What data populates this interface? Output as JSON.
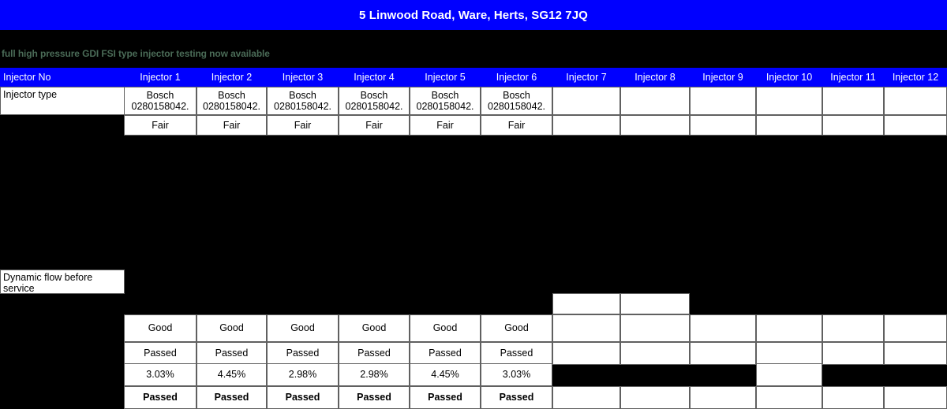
{
  "header": {
    "address": "5 Linwood Road, Ware, Herts, SG12 7JQ",
    "background_color": "#0000FF",
    "text_color": "#FFFFFF"
  },
  "marquee": {
    "text": "full high pressure GDI FSI type injector testing now available"
  },
  "table": {
    "header_background": "#0000FF",
    "header_text_color": "#FFFFFF",
    "row_label_header": "Injector No",
    "columns": [
      "Injector 1",
      "Injector 2",
      "Injector 3",
      "Injector 4",
      "Injector 5",
      "Injector 6",
      "Injector 7",
      "Injector 8",
      "Injector 9",
      "Injector 10",
      "Injector 11",
      "Injector 12"
    ],
    "rows": [
      {
        "label": "Injector type",
        "label_visible": true,
        "values": [
          "Bosch\n0280158042.",
          "Bosch\n0280158042.",
          "Bosch\n0280158042.",
          "Bosch\n0280158042.",
          "Bosch\n0280158042.",
          "Bosch\n0280158042.",
          "",
          "",
          "",
          "",
          "",
          ""
        ]
      },
      {
        "label": "",
        "label_visible": false,
        "values": [
          "Fair",
          "Fair",
          "Fair",
          "Fair",
          "Fair",
          "Fair",
          "",
          "",
          "",
          "",
          "",
          ""
        ]
      },
      {
        "label": "Dynamic flow before service",
        "label_visible": true,
        "values": [
          "",
          "",
          "",
          "",
          "",
          "",
          "",
          "",
          "",
          "",
          "",
          ""
        ]
      },
      {
        "label": "",
        "label_visible": false,
        "values": [
          "",
          "",
          "",
          "",
          "",
          "",
          "",
          "",
          "",
          "",
          "",
          ""
        ]
      },
      {
        "label": "",
        "label_visible": false,
        "values": [
          "Good",
          "Good",
          "Good",
          "Good",
          "Good",
          "Good",
          "",
          "",
          "",
          "",
          "",
          ""
        ]
      },
      {
        "label": "",
        "label_visible": false,
        "values": [
          "Passed",
          "Passed",
          "Passed",
          "Passed",
          "Passed",
          "Passed",
          "",
          "",
          "",
          "",
          "",
          ""
        ]
      },
      {
        "label": "",
        "label_visible": false,
        "values": [
          "3.03%",
          "4.45%",
          "2.98%",
          "2.98%",
          "4.45%",
          "3.03%",
          "",
          "",
          "",
          "",
          "",
          ""
        ]
      },
      {
        "label": "",
        "label_visible": false,
        "values": [
          "Passed",
          "Passed",
          "Passed",
          "Passed",
          "Passed",
          "Passed",
          "",
          "",
          "",
          "",
          "",
          ""
        ]
      }
    ]
  }
}
